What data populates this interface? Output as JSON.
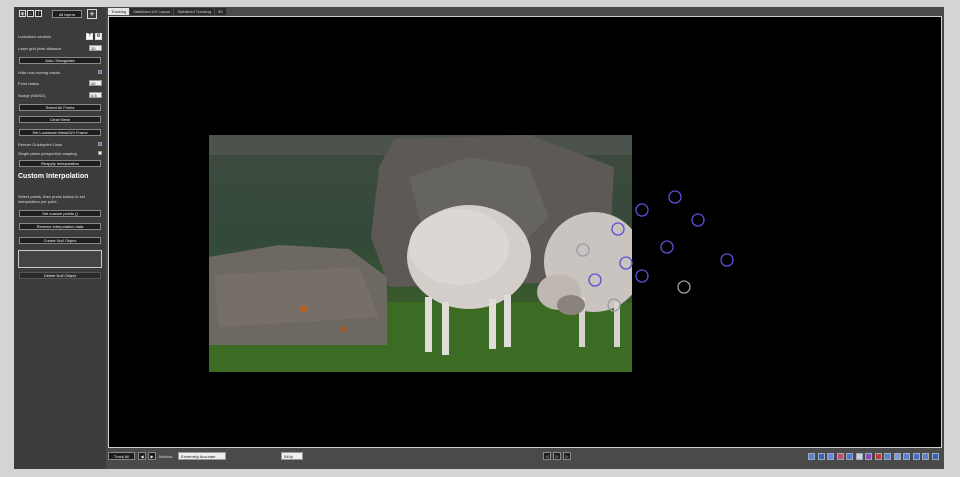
{
  "toolbar": {
    "all_layers_label": "All layers",
    "add_icon": "plus-icon"
  },
  "tabs": [
    {
      "label": "Tracking"
    },
    {
      "label": "Stabilized UV Layout"
    },
    {
      "label": "Stabilized Tracking"
    },
    {
      "label": "3D"
    }
  ],
  "sidebar": {
    "lockdown_controls": "Lockdown controls",
    "laser_grid_label": "Laser grid pixel distance",
    "laser_grid_value": "30",
    "auto_triangulate": "Auto-Triangulate",
    "hide_non_moving": "Hide non-moving tracks",
    "point_radius_label": "Point radius",
    "point_radius_value": "40",
    "nudge_label": "Nudge (WASD)",
    "nudge_value": "0.5",
    "select_all_points": "Select All Points",
    "clear_mesh": "Clear Mesh",
    "set_lockdown_frame": "Set Lockdown Mesh/UV Frame",
    "render_guidepoint_links": "Render Guidepoint Links",
    "single_plane_warping": "Single plane perspective warping",
    "reapply_interpolation": "Reapply Interpolation",
    "custom_interpolation_title": "Custom Interpolation",
    "custom_interpolation_desc": "Select points, then press button to set interpolation per point.",
    "set_custom_points": "Set custom points ()",
    "remove_interpolation": "Remove interpolation data",
    "create_null_object": "Create Null Object",
    "delete_null_object": "Delete Null Object"
  },
  "bottom": {
    "track_all": "Track All",
    "method_label": "Method",
    "method_value": "Extremely Accurate",
    "resolution_value": "540p"
  },
  "colors": {
    "track_circle": "#5a4fd8",
    "accent": "#3a6ed8"
  }
}
